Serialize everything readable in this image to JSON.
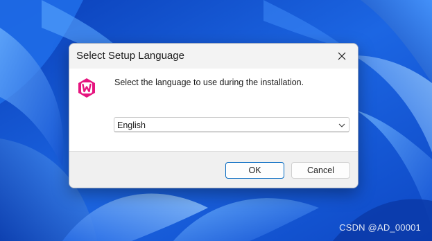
{
  "dialog": {
    "title": "Select Setup Language",
    "prompt": "Select the language to use during the installation.",
    "language_select": {
      "selected": "English"
    },
    "buttons": {
      "ok_label": "OK",
      "cancel_label": "Cancel"
    },
    "icons": {
      "app": "wampserver-icon",
      "close": "close-icon",
      "dropdown": "chevron-down-icon"
    }
  },
  "watermark": {
    "text": "CSDN @AD_00001"
  },
  "colors": {
    "wallpaper_blue": "#1a5fd9",
    "app_icon_pink": "#e6157f",
    "ok_button_border": "#0067c0"
  }
}
